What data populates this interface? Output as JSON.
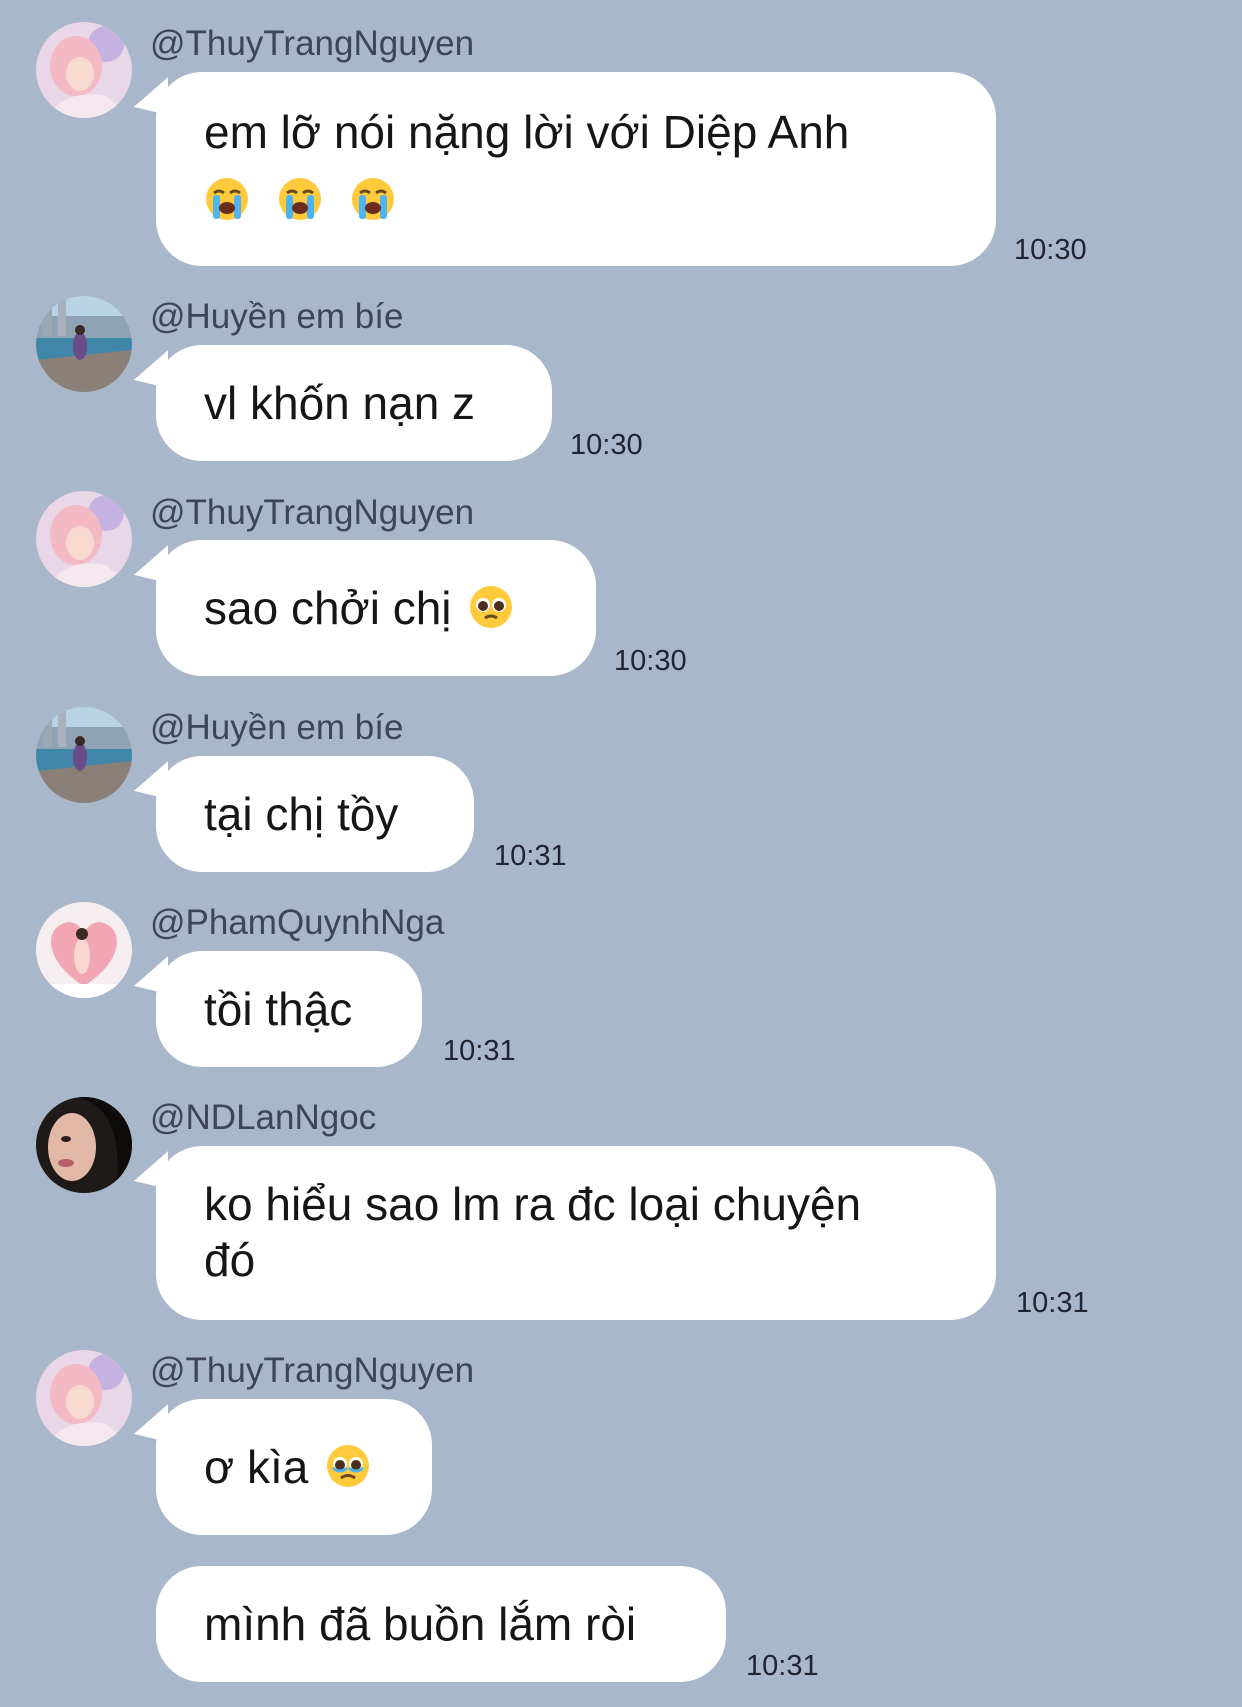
{
  "messages": [
    {
      "sender": "@ThuyTrangNguyen",
      "avatar": "avatar-thuytrang",
      "line1": "em lỡ nói nặng lời với Diệp Anh",
      "emoji": [
        "loudly-crying-face-icon",
        "loudly-crying-face-icon",
        "loudly-crying-face-icon"
      ],
      "time": "10:30"
    },
    {
      "sender": "@Huyền em bíe",
      "avatar": "avatar-huyen",
      "text": "vl khốn nạn z",
      "time": "10:30"
    },
    {
      "sender": "@ThuyTrangNguyen",
      "avatar": "avatar-thuytrang",
      "text": "sao chởi chị",
      "emoji": "pleading-face-icon",
      "time": "10:30"
    },
    {
      "sender": "@Huyền em bíe",
      "avatar": "avatar-huyen",
      "text": "tại chị tồy",
      "time": "10:31"
    },
    {
      "sender": "@PhamQuynhNga",
      "avatar": "avatar-phamquynhnga",
      "text": "tồi thậc",
      "time": "10:31"
    },
    {
      "sender": "@NDLanNgoc",
      "avatar": "avatar-ndlanngoc",
      "text": "ko hiểu sao lm ra đc loại chuyện\nđó",
      "time": "10:31"
    },
    {
      "sender": "@ThuyTrangNguyen",
      "avatar": "avatar-thuytrang",
      "text": "ơ kìa",
      "emoji": "face-holding-back-tears-icon"
    },
    {
      "text": "mình đã buồn lắm ròi",
      "time": "10:31"
    }
  ],
  "colors": {
    "background": "#a9b7cb",
    "bubble": "#ffffff",
    "sender": "#3d4656",
    "time": "#1f2430"
  }
}
